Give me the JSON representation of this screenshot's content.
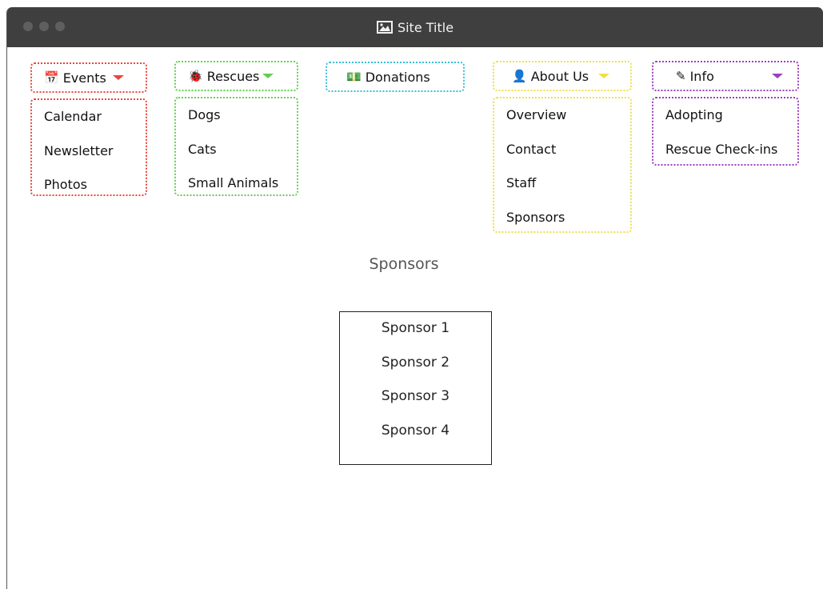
{
  "window": {
    "title": "Site Title",
    "title_icon": "image-icon"
  },
  "menus": [
    {
      "label": "Events",
      "icon": "calendar-icon",
      "glyph": "📅",
      "color": "#e8463c",
      "caret": true,
      "items": [
        "Calendar",
        "Newsletter",
        "Photos"
      ]
    },
    {
      "label": "Rescues",
      "icon": "bug-icon",
      "glyph": "🐞",
      "color": "#5fd04a",
      "caret": true,
      "items": [
        "Dogs",
        "Cats",
        "Small Animals"
      ]
    },
    {
      "label": "Donations",
      "icon": "money-icon",
      "glyph": "💵",
      "color": "#39bfd8",
      "caret": false,
      "items": []
    },
    {
      "label": "About Us",
      "icon": "user-icon",
      "glyph": "👤",
      "color": "#f1df4a",
      "caret": true,
      "items": [
        "Overview",
        "Contact",
        "Staff",
        "Sponsors"
      ]
    },
    {
      "label": "Info",
      "icon": "edit-icon",
      "glyph": "✎",
      "color": "#9b3fc0",
      "caret": true,
      "items": [
        "Adopting",
        "Rescue Check-ins"
      ]
    }
  ],
  "content": {
    "heading": "Sponsors",
    "sponsors": [
      "Sponsor 1",
      "Sponsor 2",
      "Sponsor 3",
      "Sponsor 4"
    ]
  }
}
